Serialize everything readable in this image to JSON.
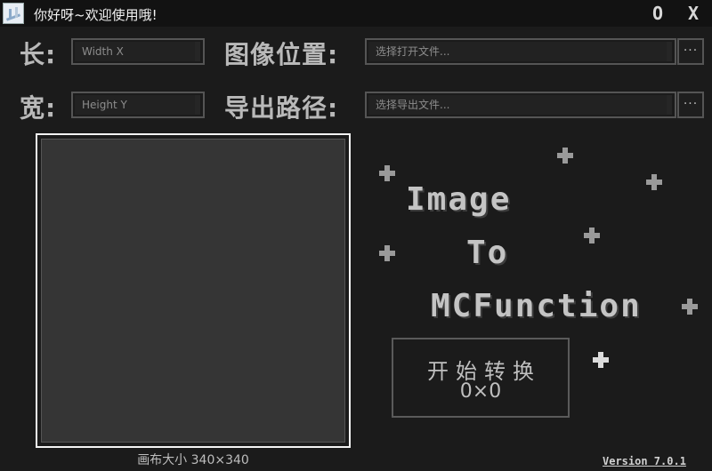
{
  "window": {
    "title": "你好呀~欢迎使用哦!",
    "minimize_label": "O",
    "close_label": "X"
  },
  "size_fields": {
    "width_label": "长:",
    "width_placeholder": "Width X",
    "height_label": "宽:",
    "height_placeholder": "Height Y"
  },
  "path_fields": {
    "image_label": "图像位置:",
    "image_placeholder": "选择打开文件...",
    "export_label": "导出路径:",
    "export_placeholder": "选择导出文件...",
    "browse_label": "···"
  },
  "canvas": {
    "size_text": "画布大小 340×340"
  },
  "banner": {
    "line1": "Image",
    "line2": "To",
    "line3": "MCFunction"
  },
  "start_button": {
    "label": "开始转换",
    "dimensions": "0×0"
  },
  "version": "Version 7.0.1",
  "colors": {
    "background": "#1b1b1b",
    "titlebar": "#121212",
    "canvas_fill": "#353535",
    "canvas_border": "#f3f3f3",
    "text_gray": "#c4c4c4"
  }
}
